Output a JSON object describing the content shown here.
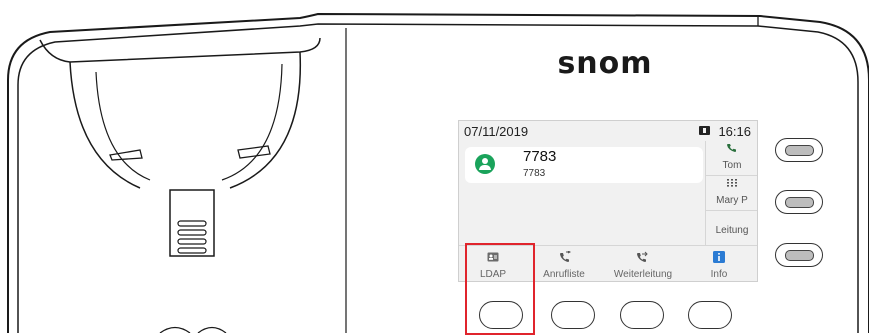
{
  "brand": "snom",
  "status_bar": {
    "date": "07/11/2019",
    "time": "16:16",
    "battery_icon": "battery-icon"
  },
  "active_call": {
    "name": "7783",
    "number": "7783",
    "avatar_icon": "contact-avatar-icon",
    "avatar_color": "#1aa35b"
  },
  "side_keys": [
    {
      "label": "Tom",
      "icon": "phone-icon"
    },
    {
      "label": "Mary P",
      "icon": "dialpad-icon"
    },
    {
      "label": "Leitung",
      "icon": ""
    }
  ],
  "tabs": [
    {
      "label": "LDAP",
      "icon": "directory-icon"
    },
    {
      "label": "Anrufliste",
      "icon": "call-list-icon"
    },
    {
      "label": "Weiterleitung",
      "icon": "call-forward-icon"
    },
    {
      "label": "Info",
      "icon": "info-icon"
    }
  ],
  "colors": {
    "highlight": "#e0242c",
    "info_blue": "#2b7bd3",
    "call_green": "#1aa35b"
  }
}
